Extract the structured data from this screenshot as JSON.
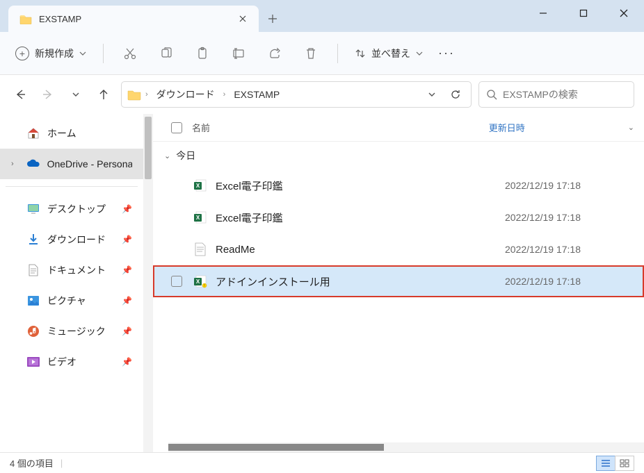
{
  "tab": {
    "title": "EXSTAMP"
  },
  "toolbar": {
    "new_label": "新規作成",
    "sort_label": "並べ替え"
  },
  "breadcrumb": {
    "items": [
      "ダウンロード",
      "EXSTAMP"
    ]
  },
  "search": {
    "placeholder": "EXSTAMPの検索"
  },
  "sidebar": {
    "home": "ホーム",
    "onedrive": "OneDrive - Personal",
    "quick": [
      {
        "label": "デスクトップ",
        "icon": "desktop"
      },
      {
        "label": "ダウンロード",
        "icon": "download"
      },
      {
        "label": "ドキュメント",
        "icon": "document"
      },
      {
        "label": "ピクチャ",
        "icon": "pictures"
      },
      {
        "label": "ミュージック",
        "icon": "music"
      },
      {
        "label": "ビデオ",
        "icon": "video"
      }
    ]
  },
  "columns": {
    "name": "名前",
    "date": "更新日時"
  },
  "group": {
    "today": "今日"
  },
  "files": [
    {
      "name": "Excel電子印鑑",
      "date": "2022/12/19 17:18",
      "type": "excel-addin"
    },
    {
      "name": "Excel電子印鑑",
      "date": "2022/12/19 17:18",
      "type": "excel"
    },
    {
      "name": "ReadMe",
      "date": "2022/12/19 17:18",
      "type": "text"
    },
    {
      "name": "アドインインストール用",
      "date": "2022/12/19 17:18",
      "type": "excel-macro",
      "selected": true
    }
  ],
  "status": {
    "count": "4 個の項目"
  }
}
